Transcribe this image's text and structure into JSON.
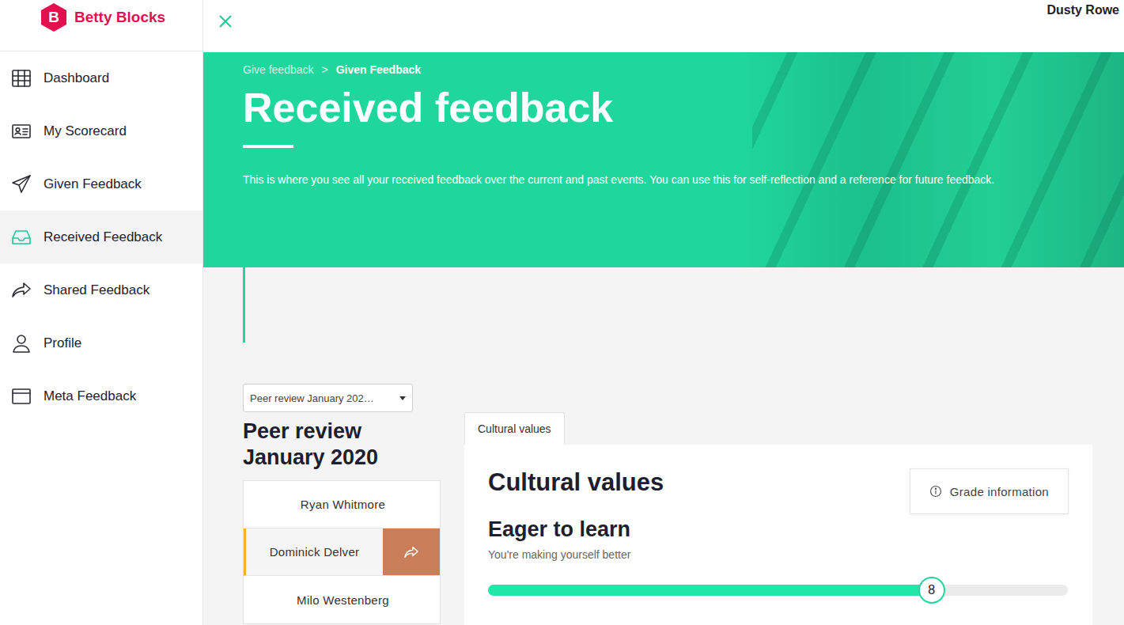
{
  "logo": {
    "mark": "B",
    "name": "Betty Blocks"
  },
  "user": "Dusty Rowe",
  "sidebar": {
    "items": [
      {
        "label": "Dashboard",
        "selected": false
      },
      {
        "label": "My Scorecard",
        "selected": false
      },
      {
        "label": "Given Feedback",
        "selected": false
      },
      {
        "label": "Received Feedback",
        "selected": true
      },
      {
        "label": "Shared Feedback",
        "selected": false
      },
      {
        "label": "Profile",
        "selected": false
      },
      {
        "label": "Meta Feedback",
        "selected": false
      }
    ]
  },
  "hero": {
    "breadcrumb": [
      "Give feedback",
      "Given Feedback"
    ],
    "separator": ">",
    "title": "Received feedback",
    "description": "This is where you see all your received feedback over the current and past events. You can use this for self-reflection and a reference for future feedback."
  },
  "event_select": {
    "value": "Peer review January 202…"
  },
  "event_title": "Peer review January 2020",
  "people": [
    {
      "name": "Ryan Whitmore",
      "selected": false
    },
    {
      "name": "Dominick Delver",
      "selected": true
    },
    {
      "name": "Milo Westenberg",
      "selected": false
    }
  ],
  "tabs": [
    {
      "label": "Cultural values",
      "selected": true
    }
  ],
  "card": {
    "title": "Cultural values",
    "grade_button": "Grade information",
    "values": [
      {
        "name": "Eager to learn",
        "description": "You're making yourself better",
        "score": "8",
        "level": 0.765
      }
    ]
  }
}
